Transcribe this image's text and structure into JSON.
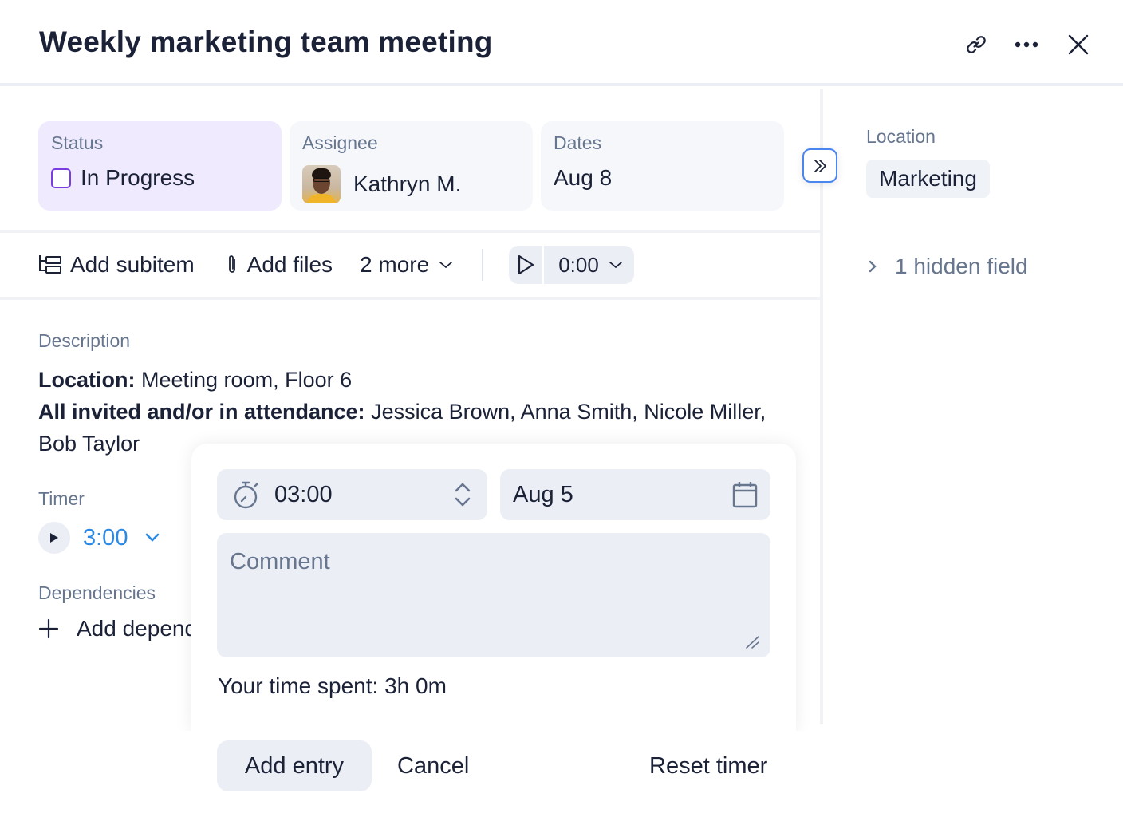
{
  "header": {
    "title": "Weekly marketing team meeting",
    "icons": [
      "link-icon",
      "more-icon",
      "close-icon"
    ]
  },
  "fields": {
    "status": {
      "label": "Status",
      "value": "In Progress",
      "color": "#7a3de0",
      "bg": "#efeafd"
    },
    "assignee": {
      "label": "Assignee",
      "value": "Kathryn M."
    },
    "dates": {
      "label": "Dates",
      "value": "Aug 8"
    }
  },
  "toolbar": {
    "add_subitem": "Add subitem",
    "add_files": "Add files",
    "more": "2 more",
    "timer_value": "0:00"
  },
  "description": {
    "label": "Description",
    "location_key": "Location:",
    "location_value": " Meeting room, Floor 6",
    "attendance_key": "All invited and/or in attendance:",
    "attendance_value": " Jessica Brown, Anna Smith, Nicole Miller, Bob Taylor"
  },
  "timer": {
    "label": "Timer",
    "value": "3:00",
    "accent": "#2a8ae6"
  },
  "dependencies": {
    "label": "Dependencies",
    "add_label": "Add dependency"
  },
  "sidebar": {
    "location_label": "Location",
    "location_value": "Marketing",
    "hidden_fields": "1 hidden field"
  },
  "time_entry_popup": {
    "duration": "03:00",
    "date": "Aug 5",
    "comment_placeholder": "Comment",
    "comment_value": "",
    "time_spent": "Your time spent: 3h 0m",
    "add_entry": "Add entry",
    "cancel": "Cancel",
    "reset_timer": "Reset timer"
  }
}
